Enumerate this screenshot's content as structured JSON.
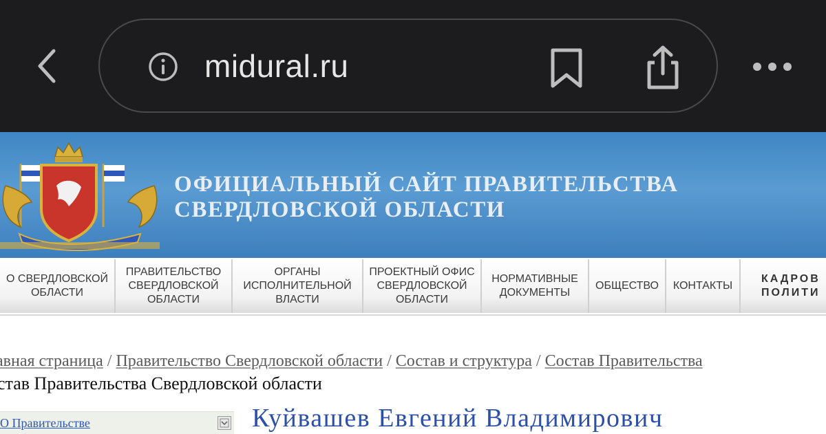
{
  "browser": {
    "url": "midural.ru",
    "icons": {
      "back": "chevron-left-icon",
      "info": "info-icon",
      "bookmark": "bookmark-icon",
      "share": "share-icon",
      "more": "more-dots-icon"
    }
  },
  "site": {
    "title_line1": "ОФИЦИАЛЬНЫЙ САЙТ ПРАВИТЕЛЬСТВА",
    "title_line2": "СВЕРДЛОВСКОЙ ОБЛАСТИ",
    "logo": "coat-of-arms-icon"
  },
  "nav": {
    "items": [
      {
        "line1": "О СВЕРДЛОВСКОЙ",
        "line2": "ОБЛАСТИ",
        "line3": ""
      },
      {
        "line1": "ПРАВИТЕЛЬСТВО",
        "line2": "СВЕРДЛОВСКОЙ",
        "line3": "ОБЛАСТИ"
      },
      {
        "line1": "ОРГАНЫ",
        "line2": "ИСПОЛНИТЕЛЬНОЙ",
        "line3": "ВЛАСТИ"
      },
      {
        "line1": "ПРОЕКТНЫЙ ОФИС",
        "line2": "СВЕРДЛОВСКОЙ",
        "line3": "ОБЛАСТИ"
      },
      {
        "line1": "НОРМАТИВНЫЕ",
        "line2": "ДОКУМЕНТЫ",
        "line3": ""
      },
      {
        "line1": "ОБЩЕСТВО",
        "line2": "",
        "line3": ""
      },
      {
        "line1": "КОНТАКТЫ",
        "line2": "",
        "line3": ""
      },
      {
        "line1": "КАДРОВ",
        "line2": "ПОЛИТИ",
        "line3": ""
      }
    ]
  },
  "breadcrumb": {
    "items": [
      "авная страница",
      "Правительство Свердловской области",
      "Состав и структура",
      "Состав Правительства"
    ],
    "separator": "/"
  },
  "page": {
    "heading": "став Правительства Свердловской области",
    "sidebar_link": "О Правительстве",
    "person_name": "Куйвашев Евгений Владимирович"
  },
  "colors": {
    "chrome_bg": "#1c1c1e",
    "header_blue": "#4a8fcb",
    "link_blue": "#2a56b5"
  }
}
